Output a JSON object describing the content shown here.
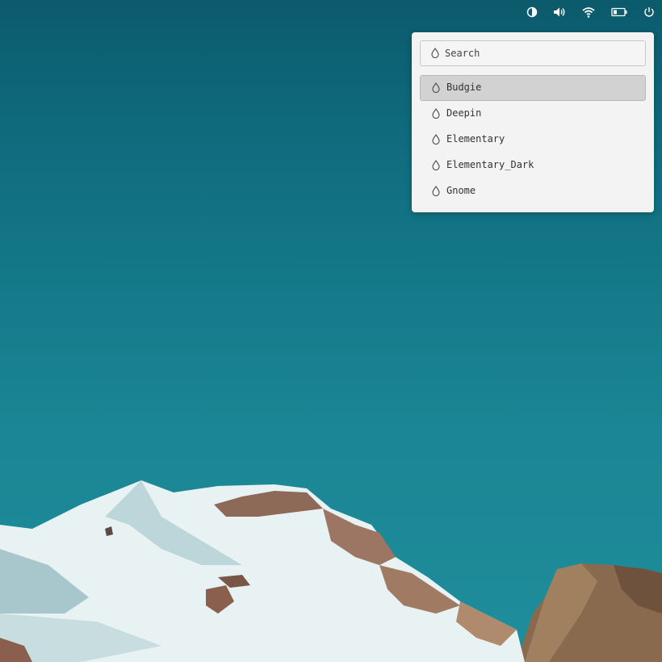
{
  "tray": {
    "icons": [
      "contrast-icon",
      "volume-icon",
      "wifi-icon",
      "battery-icon",
      "power-icon"
    ]
  },
  "popup": {
    "search": {
      "placeholder": "Search",
      "icon": "drop-icon"
    },
    "items": [
      {
        "label": "Budgie",
        "selected": true
      },
      {
        "label": "Deepin"
      },
      {
        "label": "Elementary"
      },
      {
        "label": "Elementary_Dark"
      },
      {
        "label": "Gnome"
      }
    ]
  },
  "colors": {
    "sky_top": "#0b5a6c",
    "sky_bottom": "#1f8d9b",
    "popup_bg": "#f3f3f3",
    "selected_bg": "#d2d2d2"
  }
}
